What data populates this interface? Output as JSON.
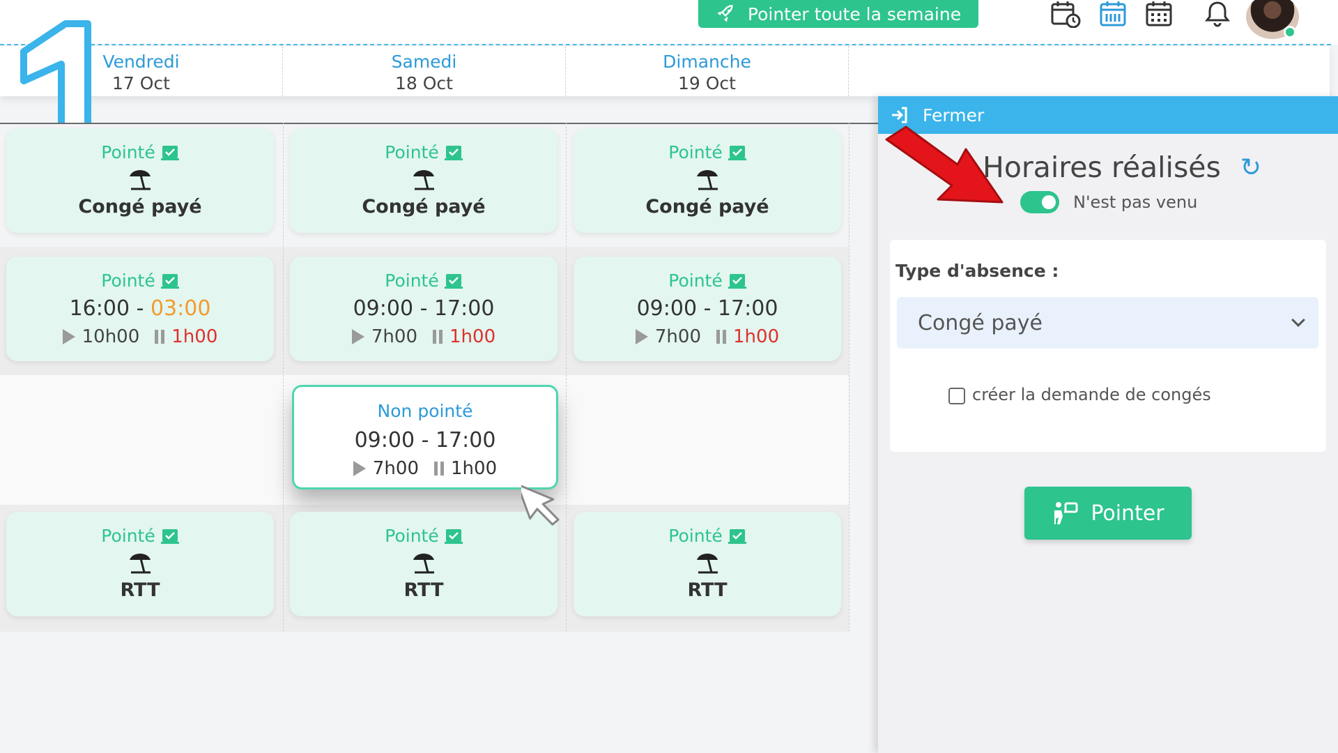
{
  "topbar": {
    "week_button": "Pointer toute la semaine"
  },
  "step_badge": "1",
  "days": [
    {
      "name": "Vendredi",
      "date": "17 Oct"
    },
    {
      "name": "Samedi",
      "date": "18 Oct"
    },
    {
      "name": "Dimanche",
      "date": "19 Oct"
    }
  ],
  "rows": {
    "leave": {
      "status": "Pointé",
      "label": "Congé payé"
    },
    "shift": [
      {
        "status": "Pointé",
        "start": "16:00",
        "sep": " - ",
        "end": "03:00",
        "worked": "10h00",
        "pause": "1h00"
      },
      {
        "status": "Pointé",
        "start": "09:00",
        "sep": " - ",
        "end": "17:00",
        "worked": "7h00",
        "pause": "1h00"
      },
      {
        "status": "Pointé",
        "start": "09:00",
        "sep": " - ",
        "end": "17:00",
        "worked": "7h00",
        "pause": "1h00"
      }
    ],
    "unpointed": {
      "status": "Non pointé",
      "time": "09:00 - 17:00",
      "worked": "7h00",
      "pause": "1h00"
    },
    "rtt": {
      "status": "Pointé",
      "label": "RTT"
    }
  },
  "panel": {
    "close_label": "Fermer",
    "title": "Horaires réalisés",
    "toggle_label": "N'est pas venu",
    "toggle_on": true,
    "absence_label": "Type d'absence :",
    "absence_value": "Congé payé",
    "checkbox_label": "créer la demande de congés",
    "checkbox_checked": false,
    "submit_label": "Pointer"
  },
  "colors": {
    "accent_green": "#2dc48d",
    "accent_blue": "#2c9ad8",
    "header_blue": "#3ab4ea",
    "late_orange": "#f39a2e",
    "pause_red": "#e0302c",
    "arrow_red": "#e3151a"
  }
}
